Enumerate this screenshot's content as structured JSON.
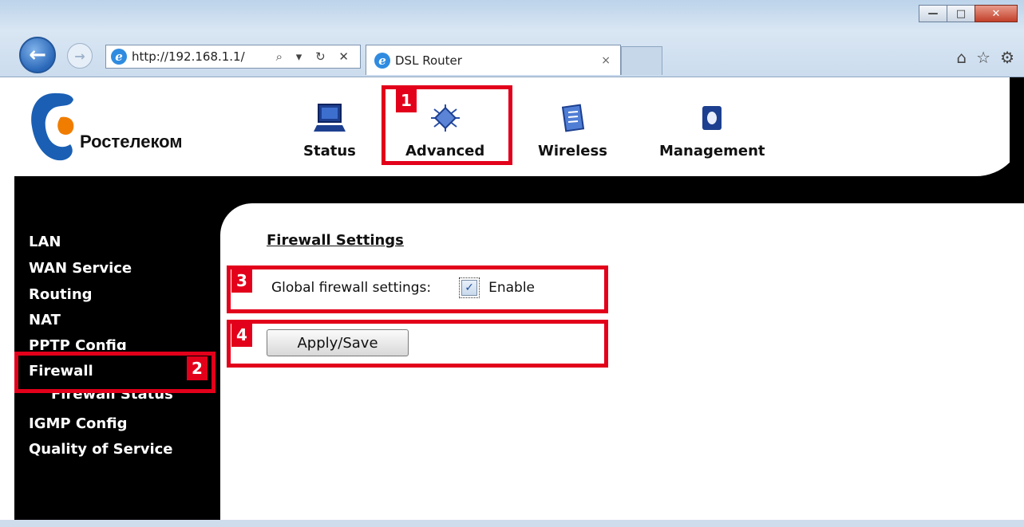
{
  "browser": {
    "address": "http://192.168.1.1/",
    "address_tools": "⌕ ▾ ↻ ✕",
    "tab_title": "DSL Router",
    "tab_close": "×",
    "window_minimize": "—",
    "window_maximize": "□",
    "window_close": "✕",
    "back_glyph": "←",
    "forward_glyph": "→",
    "home_glyph": "⌂",
    "favorites_glyph": "☆",
    "settings_glyph": "⚙"
  },
  "header": {
    "brand": "Ростелеком",
    "nav": [
      {
        "label": "Status",
        "icon": "status-monitor-icon"
      },
      {
        "label": "Advanced",
        "icon": "advanced-chip-icon"
      },
      {
        "label": "Wireless",
        "icon": "wireless-clipboard-icon"
      },
      {
        "label": "Management",
        "icon": "management-book-icon"
      }
    ]
  },
  "sidebar": {
    "items": [
      {
        "label": "LAN"
      },
      {
        "label": "WAN Service"
      },
      {
        "label": "Routing"
      },
      {
        "label": "NAT"
      },
      {
        "label": "PPTP Config"
      },
      {
        "label": "Firewall"
      },
      {
        "label": "Firewall Status"
      },
      {
        "label": "IGMP Config"
      },
      {
        "label": "Quality of Service"
      }
    ]
  },
  "main": {
    "title": "Firewall Settings",
    "global_label": "Global firewall settings:",
    "enable_label": "Enable",
    "enable_checked": true,
    "apply_label": "Apply/Save"
  },
  "annotations": [
    "1",
    "2",
    "3",
    "4"
  ],
  "colors": {
    "annotation_red": "#e2001a",
    "brand_blue": "#1a5fb4",
    "brand_orange": "#f07d00"
  }
}
